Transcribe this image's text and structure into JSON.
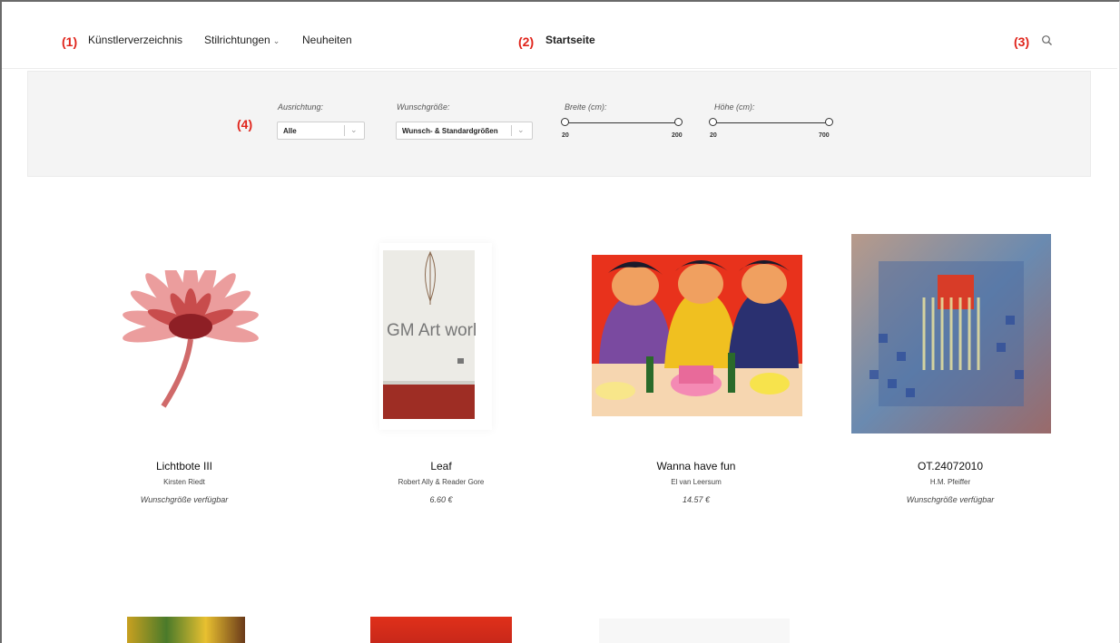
{
  "annotations": [
    "(1)",
    "(2)",
    "(3)",
    "(4)"
  ],
  "nav": {
    "artists": "Künstlerverzeichnis",
    "styles": "Stilrichtungen",
    "news": "Neuheiten",
    "home": "Startseite"
  },
  "filters": {
    "orientation_label": "Ausrichtung:",
    "orientation_value": "Alle",
    "size_label": "Wunschgröße:",
    "size_value": "Wunsch- & Standardgrößen",
    "width_label": "Breite (cm):",
    "width_min": "20",
    "width_max": "200",
    "height_label": "Höhe (cm):",
    "height_min": "20",
    "height_max": "700"
  },
  "artworks": [
    {
      "title": "Lichtbote III",
      "artist": "Kirsten Riedt",
      "info": "Wunschgröße verfügbar"
    },
    {
      "title": "Leaf",
      "artist": "Robert Ally & Reader Gore",
      "info": "6.60 €",
      "image_text": "GM Art worl"
    },
    {
      "title": "Wanna have fun",
      "artist": "El van Leersum",
      "info": "14.57 €"
    },
    {
      "title": "OT.24072010",
      "artist": "H.M. Pfeiffer",
      "info": "Wunschgröße verfügbar"
    }
  ],
  "colors": {
    "annotation": "#e0241b",
    "filter_bg": "#f4f4f4"
  }
}
